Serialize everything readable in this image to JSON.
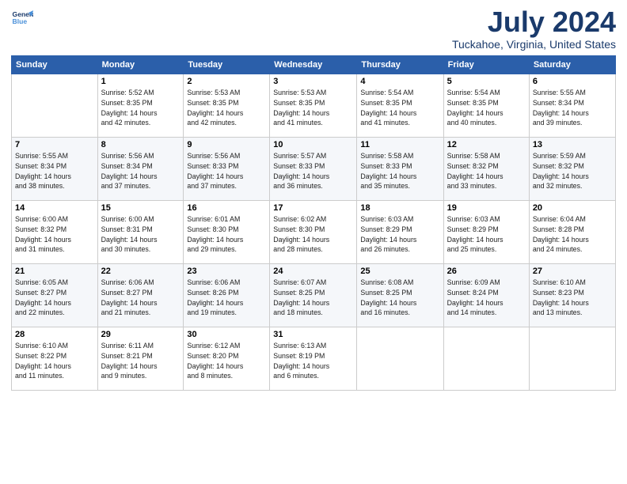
{
  "logo": {
    "line1": "General",
    "line2": "Blue"
  },
  "title": "July 2024",
  "location": "Tuckahoe, Virginia, United States",
  "days_header": [
    "Sunday",
    "Monday",
    "Tuesday",
    "Wednesday",
    "Thursday",
    "Friday",
    "Saturday"
  ],
  "weeks": [
    [
      {
        "day": "",
        "info": ""
      },
      {
        "day": "1",
        "info": "Sunrise: 5:52 AM\nSunset: 8:35 PM\nDaylight: 14 hours\nand 42 minutes."
      },
      {
        "day": "2",
        "info": "Sunrise: 5:53 AM\nSunset: 8:35 PM\nDaylight: 14 hours\nand 42 minutes."
      },
      {
        "day": "3",
        "info": "Sunrise: 5:53 AM\nSunset: 8:35 PM\nDaylight: 14 hours\nand 41 minutes."
      },
      {
        "day": "4",
        "info": "Sunrise: 5:54 AM\nSunset: 8:35 PM\nDaylight: 14 hours\nand 41 minutes."
      },
      {
        "day": "5",
        "info": "Sunrise: 5:54 AM\nSunset: 8:35 PM\nDaylight: 14 hours\nand 40 minutes."
      },
      {
        "day": "6",
        "info": "Sunrise: 5:55 AM\nSunset: 8:34 PM\nDaylight: 14 hours\nand 39 minutes."
      }
    ],
    [
      {
        "day": "7",
        "info": "Sunrise: 5:55 AM\nSunset: 8:34 PM\nDaylight: 14 hours\nand 38 minutes."
      },
      {
        "day": "8",
        "info": "Sunrise: 5:56 AM\nSunset: 8:34 PM\nDaylight: 14 hours\nand 37 minutes."
      },
      {
        "day": "9",
        "info": "Sunrise: 5:56 AM\nSunset: 8:33 PM\nDaylight: 14 hours\nand 37 minutes."
      },
      {
        "day": "10",
        "info": "Sunrise: 5:57 AM\nSunset: 8:33 PM\nDaylight: 14 hours\nand 36 minutes."
      },
      {
        "day": "11",
        "info": "Sunrise: 5:58 AM\nSunset: 8:33 PM\nDaylight: 14 hours\nand 35 minutes."
      },
      {
        "day": "12",
        "info": "Sunrise: 5:58 AM\nSunset: 8:32 PM\nDaylight: 14 hours\nand 33 minutes."
      },
      {
        "day": "13",
        "info": "Sunrise: 5:59 AM\nSunset: 8:32 PM\nDaylight: 14 hours\nand 32 minutes."
      }
    ],
    [
      {
        "day": "14",
        "info": "Sunrise: 6:00 AM\nSunset: 8:32 PM\nDaylight: 14 hours\nand 31 minutes."
      },
      {
        "day": "15",
        "info": "Sunrise: 6:00 AM\nSunset: 8:31 PM\nDaylight: 14 hours\nand 30 minutes."
      },
      {
        "day": "16",
        "info": "Sunrise: 6:01 AM\nSunset: 8:30 PM\nDaylight: 14 hours\nand 29 minutes."
      },
      {
        "day": "17",
        "info": "Sunrise: 6:02 AM\nSunset: 8:30 PM\nDaylight: 14 hours\nand 28 minutes."
      },
      {
        "day": "18",
        "info": "Sunrise: 6:03 AM\nSunset: 8:29 PM\nDaylight: 14 hours\nand 26 minutes."
      },
      {
        "day": "19",
        "info": "Sunrise: 6:03 AM\nSunset: 8:29 PM\nDaylight: 14 hours\nand 25 minutes."
      },
      {
        "day": "20",
        "info": "Sunrise: 6:04 AM\nSunset: 8:28 PM\nDaylight: 14 hours\nand 24 minutes."
      }
    ],
    [
      {
        "day": "21",
        "info": "Sunrise: 6:05 AM\nSunset: 8:27 PM\nDaylight: 14 hours\nand 22 minutes."
      },
      {
        "day": "22",
        "info": "Sunrise: 6:06 AM\nSunset: 8:27 PM\nDaylight: 14 hours\nand 21 minutes."
      },
      {
        "day": "23",
        "info": "Sunrise: 6:06 AM\nSunset: 8:26 PM\nDaylight: 14 hours\nand 19 minutes."
      },
      {
        "day": "24",
        "info": "Sunrise: 6:07 AM\nSunset: 8:25 PM\nDaylight: 14 hours\nand 18 minutes."
      },
      {
        "day": "25",
        "info": "Sunrise: 6:08 AM\nSunset: 8:25 PM\nDaylight: 14 hours\nand 16 minutes."
      },
      {
        "day": "26",
        "info": "Sunrise: 6:09 AM\nSunset: 8:24 PM\nDaylight: 14 hours\nand 14 minutes."
      },
      {
        "day": "27",
        "info": "Sunrise: 6:10 AM\nSunset: 8:23 PM\nDaylight: 14 hours\nand 13 minutes."
      }
    ],
    [
      {
        "day": "28",
        "info": "Sunrise: 6:10 AM\nSunset: 8:22 PM\nDaylight: 14 hours\nand 11 minutes."
      },
      {
        "day": "29",
        "info": "Sunrise: 6:11 AM\nSunset: 8:21 PM\nDaylight: 14 hours\nand 9 minutes."
      },
      {
        "day": "30",
        "info": "Sunrise: 6:12 AM\nSunset: 8:20 PM\nDaylight: 14 hours\nand 8 minutes."
      },
      {
        "day": "31",
        "info": "Sunrise: 6:13 AM\nSunset: 8:19 PM\nDaylight: 14 hours\nand 6 minutes."
      },
      {
        "day": "",
        "info": ""
      },
      {
        "day": "",
        "info": ""
      },
      {
        "day": "",
        "info": ""
      }
    ]
  ]
}
